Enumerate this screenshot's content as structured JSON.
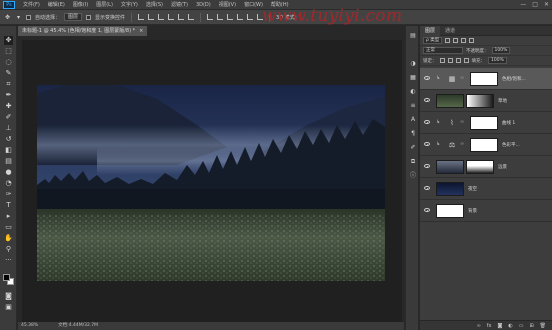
{
  "app": {
    "logo": "Ps"
  },
  "menu": [
    {
      "label": "文件(F)"
    },
    {
      "label": "编辑(E)"
    },
    {
      "label": "图像(I)"
    },
    {
      "label": "图层(L)"
    },
    {
      "label": "文字(Y)"
    },
    {
      "label": "选择(S)"
    },
    {
      "label": "滤镜(T)"
    },
    {
      "label": "3D(D)"
    },
    {
      "label": "视图(V)"
    },
    {
      "label": "窗口(W)"
    },
    {
      "label": "帮助(H)"
    }
  ],
  "window_controls": {
    "minimize": "—",
    "maximize": "□",
    "close": "✕"
  },
  "options": {
    "auto_select_label": "自动选择：",
    "auto_select_value": "图层",
    "transform_controls_label": "显示变换控件",
    "mode_3d_label": "3D 模式："
  },
  "watermark": "www.tuyiyi.com",
  "document_tab": {
    "title": "未标题-1 @ 45.4% (色相/饱和度 1, 图层蒙版/8) *",
    "close": "×"
  },
  "status": {
    "zoom": "45.38%",
    "doc_size": "文档:4.44M/32.7M"
  },
  "layers_panel": {
    "tabs": [
      {
        "label": "图层"
      },
      {
        "label": "通道"
      }
    ],
    "kind_label": "ρ 类型",
    "blend_mode": "正常",
    "opacity_label": "不透明度：",
    "opacity_value": "100%",
    "lock_label": "锁定：",
    "fill_label": "填充：",
    "fill_value": "100%",
    "layers": [
      {
        "name": "色相/饱和...",
        "type": "adjustment",
        "icon": "hue-saturation-icon",
        "thumb": "white-mask",
        "clipped": true,
        "selected": true
      },
      {
        "name": "草地",
        "type": "pixel",
        "icon": "",
        "thumb": "grass-mask",
        "clipped": false,
        "selected": false
      },
      {
        "name": "曲线 1",
        "type": "adjustment",
        "icon": "curves-icon",
        "thumb": "white-mask",
        "clipped": true,
        "selected": false
      },
      {
        "name": "色彩平...",
        "type": "adjustment",
        "icon": "color-balance-icon",
        "thumb": "white-mask",
        "clipped": true,
        "selected": false
      },
      {
        "name": "远景",
        "type": "pixel",
        "icon": "",
        "thumb": "mountain-mask",
        "clipped": false,
        "selected": false
      },
      {
        "name": "夜空",
        "type": "pixel",
        "icon": "",
        "thumb": "night-sky",
        "clipped": false,
        "selected": false
      },
      {
        "name": "背景",
        "type": "pixel",
        "icon": "",
        "thumb": "white",
        "clipped": false,
        "selected": false
      }
    ],
    "footer_icons": [
      "link-icon",
      "fx-icon",
      "mask-icon",
      "adjustment-icon",
      "group-icon",
      "new-layer-icon",
      "trash-icon"
    ],
    "footer_glyphs": [
      "∞",
      "fx",
      "◙",
      "◐",
      "▭",
      "⊞",
      "🗑"
    ]
  },
  "colors": {
    "sky": "#1f2a4a",
    "grass": "#3c4a34",
    "forest": "#121a24",
    "accent": "#31a8ff",
    "watermark": "#a8262a"
  }
}
